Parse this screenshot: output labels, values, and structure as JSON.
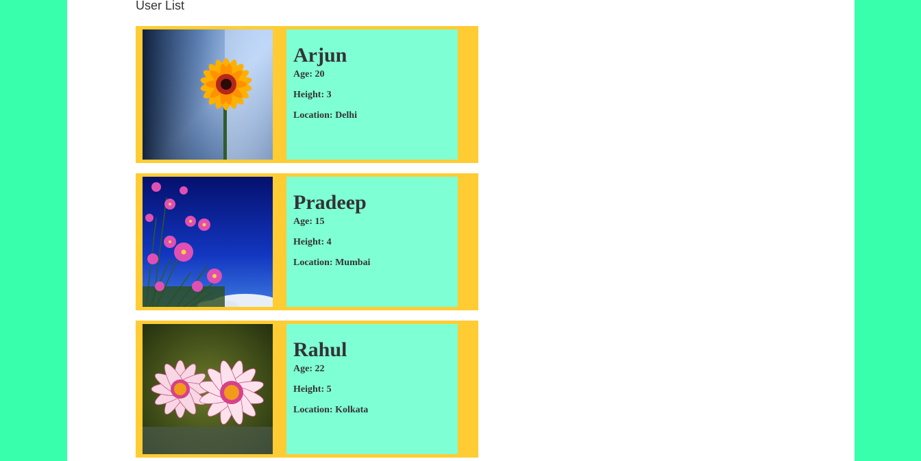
{
  "title": "User List",
  "labels": {
    "age": "Age:",
    "height": "Height:",
    "location": "Location:"
  },
  "users": [
    {
      "name": "Arjun",
      "age": "20",
      "height": "3",
      "location": "Delhi",
      "photo_icon": "orange-gerbera-flower"
    },
    {
      "name": "Pradeep",
      "age": "15",
      "height": "4",
      "location": "Mumbai",
      "photo_icon": "pink-cosmos-flowers"
    },
    {
      "name": "Rahul",
      "age": "22",
      "height": "5",
      "location": "Kolkata",
      "photo_icon": "pink-daisy-flowers"
    }
  ],
  "colors": {
    "outer_background": "#37ffab",
    "page_background": "#ffffff",
    "card_background": "#ffcc33",
    "info_background": "#7fffd4",
    "text": "#333333"
  }
}
